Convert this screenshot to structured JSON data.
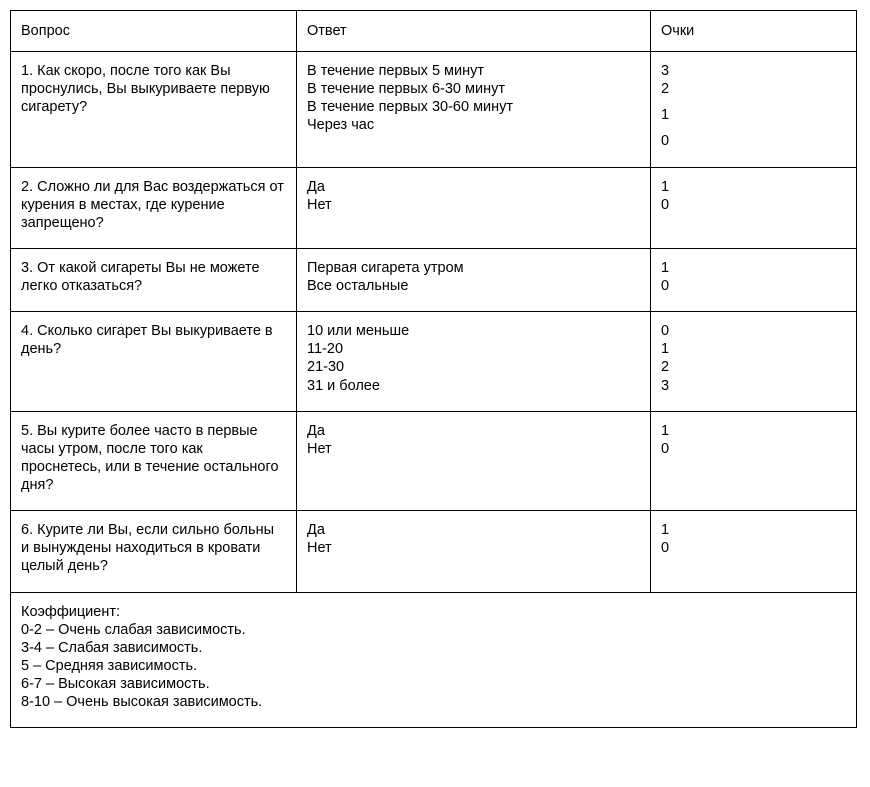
{
  "header": {
    "question": "Вопрос",
    "answer": "Ответ",
    "points": "Очки"
  },
  "rows": [
    {
      "question": "1. Как скоро, после того как Вы проснулись, Вы выкуриваете первую сигарету?",
      "answers": [
        "В течение первых 5 минут",
        "В течение первых 6-30 минут",
        "В течение первых 30-60 минут",
        "Через час"
      ],
      "points": [
        "3",
        "2",
        "",
        "1",
        "",
        "0"
      ]
    },
    {
      "question": "2. Сложно ли для Вас воздержаться от курения в местах, где курение запрещено?",
      "answers": [
        "Да",
        "Нет"
      ],
      "points": [
        "1",
        "0"
      ]
    },
    {
      "question": "3. От какой сигареты Вы не можете легко отказаться?",
      "answers": [
        "Первая сигарета утром",
        "Все остальные"
      ],
      "points": [
        "1",
        "0"
      ]
    },
    {
      "question": "4. Сколько сигарет Вы выкуриваете в день?",
      "answers": [
        "10 или меньше",
        "11-20",
        "21-30",
        "31 и более"
      ],
      "points": [
        "0",
        "1",
        "2",
        "3"
      ]
    },
    {
      "question": "5. Вы курите более часто в первые часы утром, после того как проснетесь, или в течение остального дня?",
      "answers": [
        "Да",
        "Нет"
      ],
      "points": [
        "1",
        "0"
      ]
    },
    {
      "question": "6. Курите ли Вы, если сильно больны и вынуждены находиться в кровати целый день?",
      "answers": [
        "Да",
        "Нет"
      ],
      "points": [
        "1",
        "0"
      ]
    }
  ],
  "coef": {
    "title": "Коэффициент:",
    "lines": [
      "0-2 – Очень слабая зависимость.",
      "3-4 – Слабая зависимость.",
      "5 – Средняя зависимость.",
      "6-7 – Высокая зависимость.",
      "8-10 – Очень высокая зависимость."
    ]
  }
}
